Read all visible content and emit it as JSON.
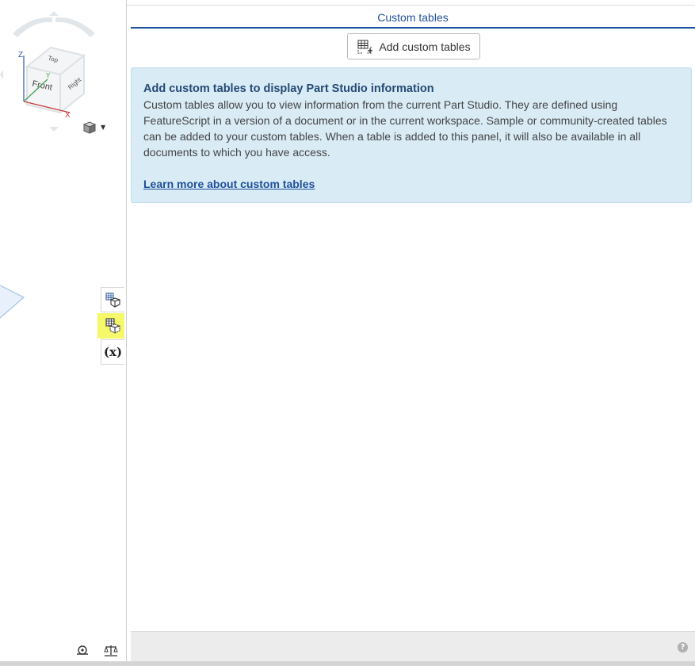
{
  "view_cube": {
    "faces": {
      "top": "Top",
      "front": "Front",
      "right": "Right"
    },
    "axes": {
      "x": "X",
      "y": "Y",
      "z": "Z"
    }
  },
  "panel": {
    "title": "Custom tables",
    "add_button_label": "Add custom tables",
    "info": {
      "heading": "Add custom tables to display Part Studio information",
      "body": "Custom tables allow you to view information from the current Part Studio. They are defined using FeatureScript in a version of a document or in the current workspace. Sample or community-created tables can be added to your custom tables. When a table is added to this panel, it will also be available in all documents to which you have access.",
      "link": "Learn more about custom tables"
    },
    "help_glyph": "?"
  },
  "side_tabs": [
    {
      "name": "tables-icon",
      "active": false
    },
    {
      "name": "custom-tables-icon",
      "active": true
    },
    {
      "name": "variable-table-icon",
      "active": false
    }
  ],
  "variable_tab_glyph": "(x)",
  "colors": {
    "accent": "#1e4f9b",
    "info_bg": "#d9ebf5",
    "highlight": "#f5f86a"
  }
}
